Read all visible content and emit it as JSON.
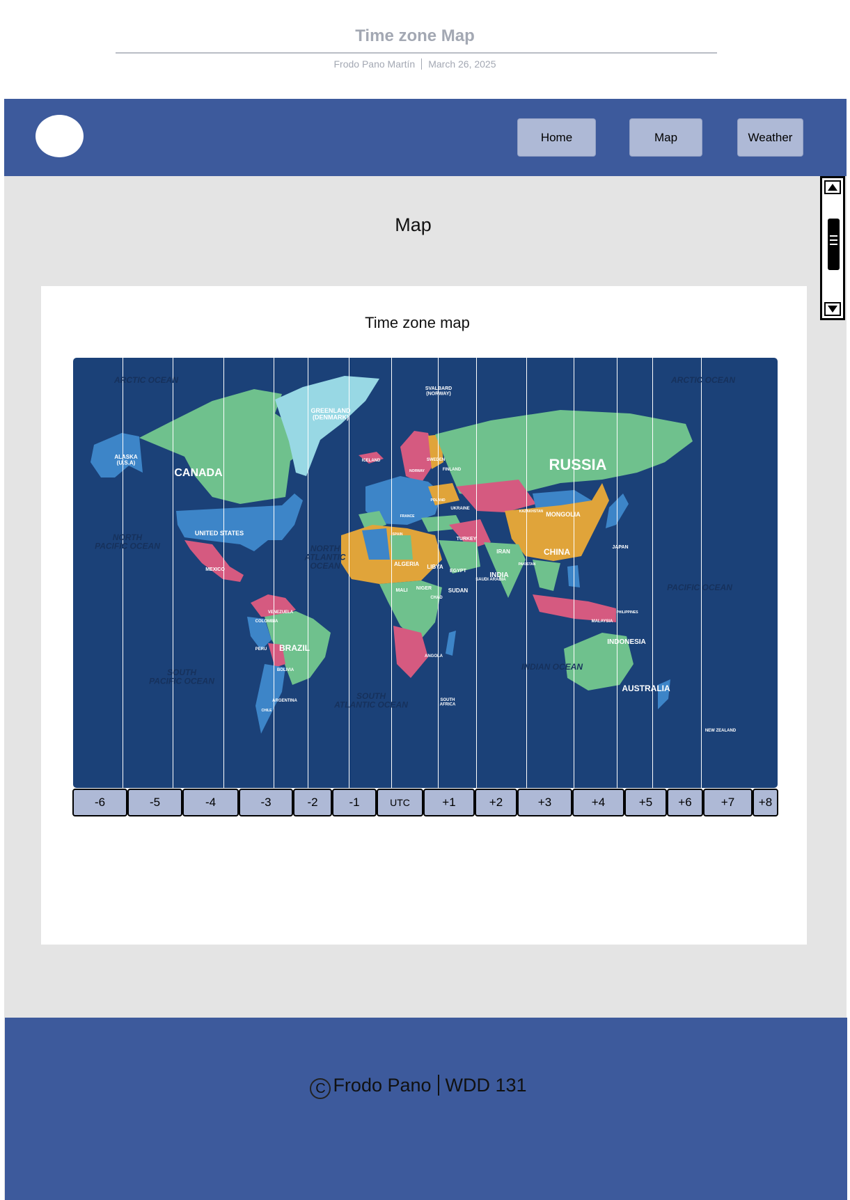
{
  "document": {
    "title": "Time zone Map",
    "author": "Frodo Pano Martín",
    "date": "March 26, 2025"
  },
  "nav": {
    "logo": "logo",
    "items": [
      {
        "label": "Home"
      },
      {
        "label": "Map"
      },
      {
        "label": "Weather"
      }
    ]
  },
  "main": {
    "heading": "Map",
    "card_title": "Time zone map"
  },
  "map_labels": {
    "arctic_west": "ARCTIC OCEAN",
    "arctic_east": "ARCTIC OCEAN",
    "alaska": "ALASKA\n(U.S.A)",
    "canada": "CANADA",
    "greenland": "GREENLAND\n(DENMARK)",
    "svalbard": "SVALBARD\n(NORWAY)",
    "iceland": "ICELAND",
    "russia": "RUSSIA",
    "united_states": "UNITED STATES",
    "mexico": "MEXICO",
    "north_pacific": "NORTH\nPACIFIC OCEAN",
    "north_atlantic": "NORTH\nATLANTIC\nOCEAN",
    "mongolia": "MONGOLIA",
    "china": "CHINA",
    "india": "INDIA",
    "japan": "JAPAN",
    "pacific": "PACIFIC OCEAN",
    "brazil": "BRAZIL",
    "south_pacific": "SOUTH\nPACIFIC OCEAN",
    "south_atlantic": "SOUTH\nATLANTIC OCEAN",
    "indian": "INDIAN OCEAN",
    "indonesia": "INDONESIA",
    "australia": "AUSTRALIA",
    "new_zealand": "NEW ZEALAND",
    "algeria": "ALGERIA",
    "libya": "LIBYA",
    "egypt": "EGYPT",
    "sudan": "SUDAN",
    "turkey": "TURKEY",
    "iran": "IRAN",
    "ukraine": "UKRAINE",
    "finland": "FINLAND",
    "sweden": "SWEDEN",
    "peru": "PERU",
    "bolivia": "BOLIVIA",
    "argentina": "ARGENTINA",
    "colombia": "COLOMBIA",
    "venezuela": "VENEZUELA",
    "angola": "ANGOLA",
    "south_africa": "SOUTH\nAFRICA",
    "mali": "MALI",
    "niger": "NIGER",
    "chad": "CHAD",
    "malaysia": "MALAYSIA",
    "saudi": "SAUDI ARABIA",
    "pakistan": "PAKISTAN",
    "kazakhstan": "KAZAKHSTAN",
    "spain": "SPAIN",
    "france": "FRANCE",
    "poland": "POLAND",
    "norway": "NORWAY",
    "chile": "CHILE",
    "philippines": "PHILIPPINES"
  },
  "timezones": [
    "-6",
    "-5",
    "-4",
    "-3",
    "-2",
    "-1",
    "UTC",
    "+1",
    "+2",
    "+3",
    "+4",
    "+5",
    "+6",
    "+7",
    "+8"
  ],
  "footer": {
    "copyright_symbol": "C",
    "name": "Frodo Pano",
    "course": "WDD 131"
  },
  "colors": {
    "nav_bg": "#3d5a9c",
    "button_bg": "#aeb9d6",
    "page_bg": "#e4e4e4",
    "ocean": "#1b4178",
    "land_green": "#6fc18d",
    "land_blue": "#3d85c8",
    "land_orange": "#e0a43a",
    "land_pink": "#d55a80",
    "greenland": "#98d8e4"
  },
  "scrollbar": {
    "up_icon": "triangle-up-icon",
    "down_icon": "triangle-down-icon",
    "position": 0.2
  }
}
